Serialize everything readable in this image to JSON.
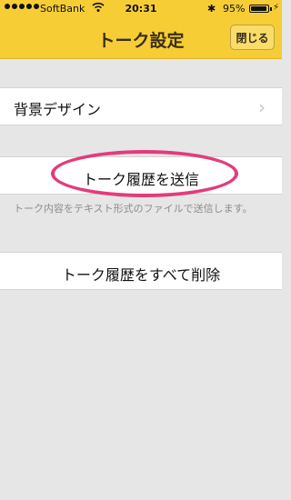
{
  "status": {
    "carrier": "SoftBank",
    "time": "20:31",
    "battery": "95%"
  },
  "nav": {
    "title": "トーク設定",
    "close_label": "閉じる"
  },
  "rows": {
    "background_design": "背景デザイン",
    "send_history": "トーク履歴を送信",
    "send_help": "トーク内容をテキスト形式のファイルで送信します。",
    "delete_history": "トーク履歴をすべて削除"
  },
  "colors": {
    "nav_bar": "#f6cd35",
    "highlight": "#e43b7e"
  }
}
